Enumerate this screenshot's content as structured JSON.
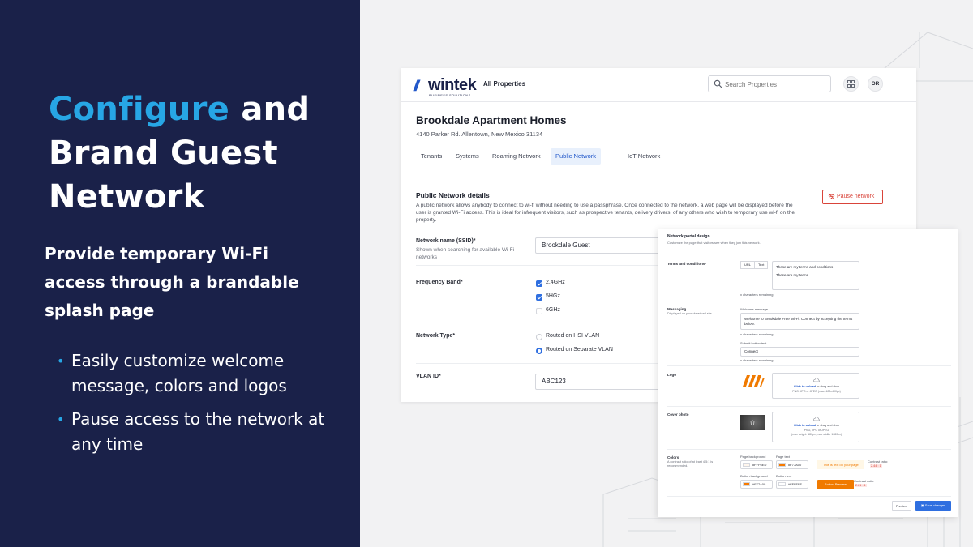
{
  "left_panel": {
    "headline_accent": "Configure",
    "headline_line1_rest": " and",
    "headline_line2": "Brand Guest",
    "headline_line3": "Network",
    "subhead": "Provide temporary Wi-Fi access through a brandable splash page",
    "bullets": [
      {
        "text": "Easily customize welcome message, colors and logos"
      },
      {
        "text": "Pause access to the network at any time"
      }
    ],
    "bullet_glyph": "•",
    "accent_color": "#27a6e5",
    "background_color": "#1a2149"
  },
  "app": {
    "logo": {
      "slashes": "//",
      "word": "wintek",
      "sub": "BUSINESS SOLUTIONS"
    },
    "nav": {
      "all_properties": "All Properties"
    },
    "search": {
      "placeholder": "Search Properties",
      "icon": "search-icon"
    },
    "grid_icon": "grid-icon",
    "avatar_initials": "OR",
    "property": {
      "title": "Brookdale Apartment Homes",
      "address": "4140 Parker Rd. Allentown, New Mexico 31134"
    },
    "tabs": [
      {
        "label": "Tenants"
      },
      {
        "label": "Systems"
      },
      {
        "label": "Roaming Network"
      },
      {
        "label": "Public Network"
      },
      {
        "label": "IoT Network"
      }
    ],
    "active_tab": "Public Network",
    "details": {
      "title": "Public Network details",
      "description": "A public network allows anybody to connect to wi-fi without needing to use a passphrase. Once connected to the network, a web page will be displayed before the user is granted Wi-Fi access. This is ideal for infrequent visitors, such as prospective tenants, delivery drivers, of any others who wish to temporary use wi-fi on the property.",
      "pause_button": "Pause network",
      "pause_icon": "wifi-off-icon"
    },
    "fields": {
      "ssid_label": "Network name (SSID)*",
      "ssid_help": "Shown when searching for available Wi-Fi networks",
      "ssid_value": "Brookdale Guest",
      "band_label": "Frequency Band*",
      "bands": [
        {
          "label": "2.4GHz",
          "checked": true
        },
        {
          "label": "5HGz",
          "checked": true
        },
        {
          "label": "6GHz",
          "checked": false
        }
      ],
      "type_label": "Network Type*",
      "types": [
        {
          "label": "Routed on HSI VLAN",
          "selected": false
        },
        {
          "label": "Routed on Separate VLAN",
          "selected": true
        }
      ],
      "vlan_label": "VLAN ID*",
      "vlan_value": "ABC123"
    }
  },
  "portal": {
    "title": "Network portal design",
    "description": "Customize the page that visitors see when they join this network.",
    "terms": {
      "label": "Terms and conditions*",
      "tab_url": "URL",
      "tab_text": "Text",
      "line1": "These are my terms and conditions",
      "line2": "These are my terms......",
      "remaining": "x characters remaining"
    },
    "messaging": {
      "label": "Messaging",
      "help": "Displayed on your download site.",
      "welcome_label": "Welcome message",
      "welcome_value": "Welcome to Brookdale Free Wi-Fi. Connect by accepting the terms below.",
      "remaining1": "x characters remaining",
      "submit_label": "Submit button text",
      "submit_value": "Connect",
      "remaining2": "x characters remaining"
    },
    "logo": {
      "label": "Logo",
      "upload_link": "Click to upload",
      "upload_rest": " or drag and drop",
      "upload_hint": "PNG, JPG or JPEG (max. 400x400px)"
    },
    "cover": {
      "label": "Cover photo",
      "upload_link": "Click to upload",
      "upload_rest": " or drag and drop",
      "upload_hint1": "PNG, JPG or JPEG",
      "upload_hint2": "(max height: 180px, max width: 1080px)"
    },
    "colors": {
      "label": "Colors",
      "help": "A contrast ratio of at least 4.5:1 is recommended.",
      "page_bg_label": "Page background",
      "page_bg_hex": "#FFF6ED",
      "page_bg_color": "#fff6ed",
      "page_text_label": "Page text",
      "page_text_hex": "#F77A00",
      "page_text_color": "#f77a00",
      "page_preview": "This is text on your page",
      "contrast_label1": "Contrast ratio:",
      "contrast_value1": "2.44 : 1",
      "button_bg_label": "Button background",
      "button_bg_hex": "#F77A00",
      "button_bg_color": "#f77a00",
      "button_text_label": "Button text",
      "button_text_hex": "#FFFFFF",
      "button_text_color": "#ffffff",
      "button_preview": "Button Preview",
      "contrast_label2": "Contrast ratio:",
      "contrast_value2": "2.81 : 1"
    },
    "actions": {
      "preview": "Preview",
      "save": "Save changes"
    }
  }
}
